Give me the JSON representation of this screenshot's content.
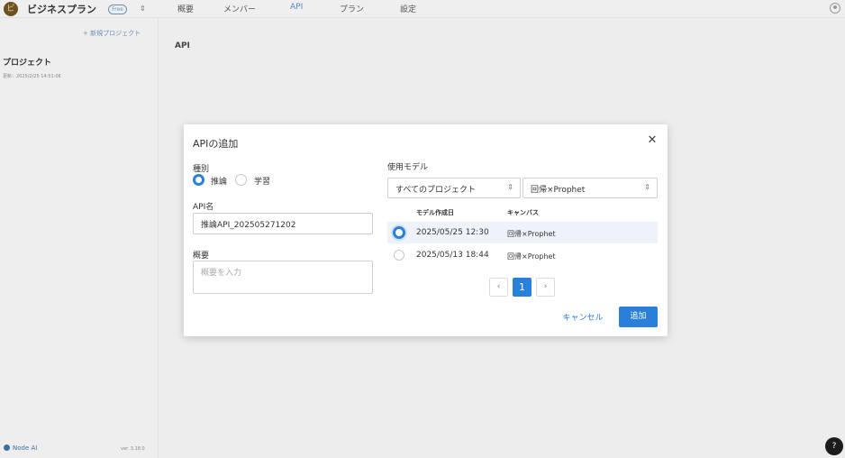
{
  "app": {
    "brand_logo_char": "ビ",
    "brand_name": "ビジネスプラン",
    "plan_badge": "Free",
    "switch_icon": "⇕",
    "tabs": [
      {
        "label": "概要"
      },
      {
        "label": "メンバー"
      },
      {
        "label": "API",
        "active": true
      },
      {
        "label": "プラン"
      },
      {
        "label": "設定"
      }
    ]
  },
  "sidebar": {
    "new_project": "+ 新規プロジェクト",
    "project_title": "プロジェクト",
    "project_updated": "更新：2025/2/25 14:51:06",
    "footer_brand": "Node AI",
    "version": "ver. 3.18.0"
  },
  "main": {
    "title": "API"
  },
  "help_label": "?",
  "modal": {
    "title": "APIの追加",
    "close_icon": "✕",
    "type_label": "種別",
    "type_options": [
      {
        "label": "推論",
        "selected": true
      },
      {
        "label": "学習",
        "selected": false
      }
    ],
    "api_name_label": "API名",
    "api_name_value": "推論API_202505271202",
    "summary_label": "概要",
    "summary_placeholder": "概要を入力",
    "model_label": "使用モデル",
    "project_select": "すべてのプロジェクト",
    "canvas_select": "回帰×Prophet",
    "table": {
      "headers": [
        "モデル作成日",
        "キャンバス"
      ],
      "rows": [
        {
          "date": "2025/05/25 12:30",
          "canvas": "回帰×Prophet",
          "selected": true
        },
        {
          "date": "2025/05/13 18:44",
          "canvas": "回帰×Prophet",
          "selected": false
        }
      ]
    },
    "pagination": {
      "prev": "‹",
      "current": "1",
      "next": "›"
    },
    "cancel_button": "キャンセル",
    "add_button": "追加"
  },
  "colors": {
    "accent": "#2a7fd9",
    "overlay": "#ededed"
  }
}
